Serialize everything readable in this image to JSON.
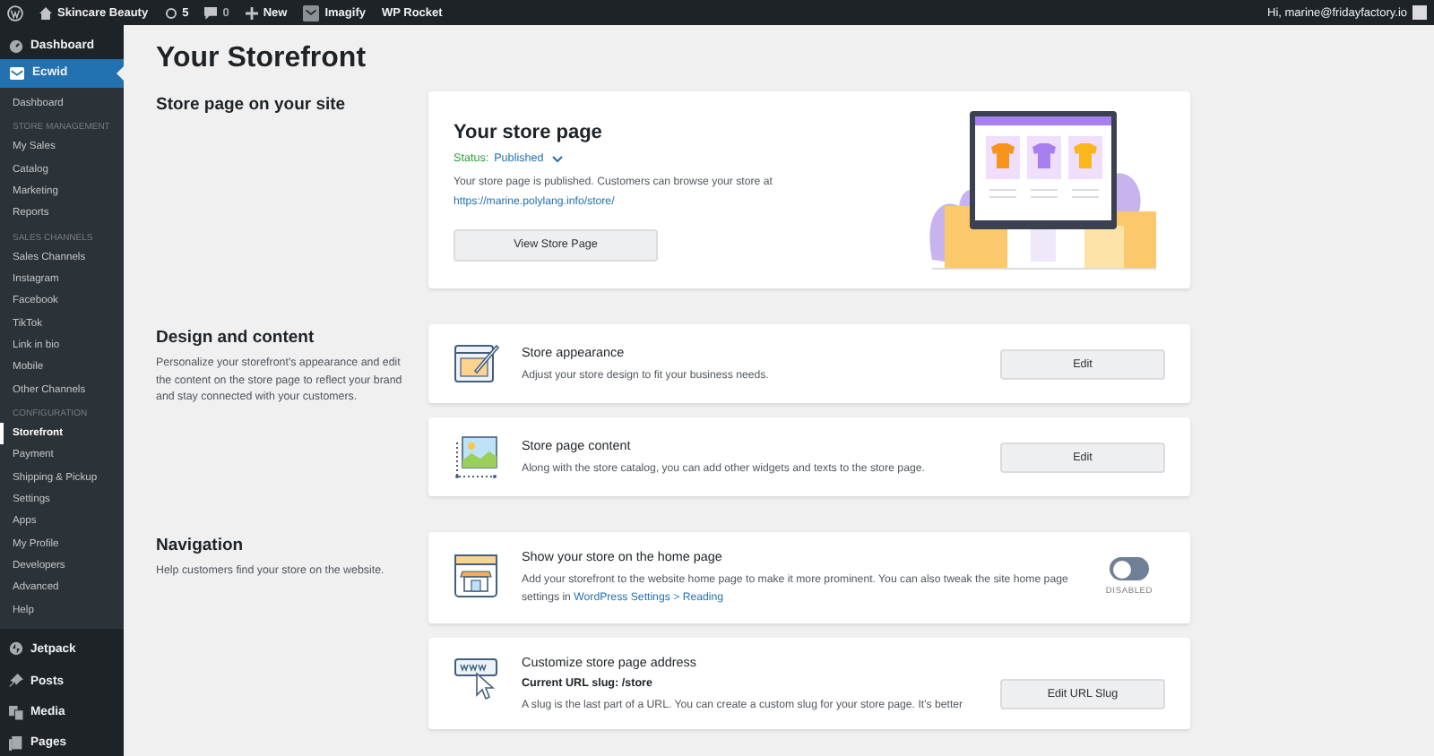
{
  "admin_bar": {
    "site_name": "Skincare Beauty",
    "updates": "5",
    "comments": "0",
    "new_label": "New",
    "plugins": [
      "Imagify",
      "WP Rocket"
    ],
    "greeting": "Hi, marine@fridayfactory.io"
  },
  "sidebar": {
    "items": [
      {
        "kind": "top",
        "label": "Dashboard",
        "selected": false
      },
      {
        "kind": "top",
        "label": "Ecwid",
        "selected": true,
        "children": [
          {
            "kind": "item",
            "label": "Dashboard",
            "selected": false
          },
          {
            "kind": "heading",
            "label": "STORE MANAGEMENT"
          },
          {
            "kind": "item",
            "label": "My Sales",
            "selected": false
          },
          {
            "kind": "item",
            "label": "Catalog",
            "selected": false
          },
          {
            "kind": "item",
            "label": "Marketing",
            "selected": false
          },
          {
            "kind": "item",
            "label": "Reports",
            "selected": false
          },
          {
            "kind": "heading",
            "label": "SALES CHANNELS"
          },
          {
            "kind": "item",
            "label": "Sales Channels",
            "selected": false
          },
          {
            "kind": "item",
            "label": "Instagram",
            "selected": false
          },
          {
            "kind": "item",
            "label": "Facebook",
            "selected": false
          },
          {
            "kind": "item",
            "label": "TikTok",
            "selected": false
          },
          {
            "kind": "item",
            "label": "Link in bio",
            "selected": false
          },
          {
            "kind": "item",
            "label": "Mobile",
            "selected": false
          },
          {
            "kind": "item",
            "label": "Other Channels",
            "selected": false
          },
          {
            "kind": "heading",
            "label": "CONFIGURATION"
          },
          {
            "kind": "item",
            "label": "Storefront",
            "selected": true
          },
          {
            "kind": "item",
            "label": "Payment",
            "selected": false
          },
          {
            "kind": "item",
            "label": "Shipping & Pickup",
            "selected": false
          },
          {
            "kind": "item",
            "label": "Settings",
            "selected": false
          },
          {
            "kind": "item",
            "label": "Apps",
            "selected": false
          },
          {
            "kind": "item",
            "label": "My Profile",
            "selected": false
          },
          {
            "kind": "item",
            "label": "Developers",
            "selected": false
          },
          {
            "kind": "item",
            "label": "Advanced",
            "selected": false
          },
          {
            "kind": "item",
            "label": "Help",
            "selected": false
          }
        ]
      },
      {
        "kind": "top",
        "label": "Jetpack",
        "selected": false
      },
      {
        "kind": "top",
        "label": "Posts",
        "selected": false
      },
      {
        "kind": "top",
        "label": "Media",
        "selected": false
      },
      {
        "kind": "top",
        "label": "Pages",
        "selected": false
      }
    ]
  },
  "page": {
    "title": "Your Storefront",
    "sections": [
      {
        "title": "Store page on your site",
        "cards": [
          {
            "kind": "store_page",
            "title": "Your store page",
            "status_label": "Status:",
            "status_value": "Published",
            "description": "Your store page is published. Customers can browse your store at",
            "link": "https://marine.polylang.info/store/",
            "button": "View Store Page"
          }
        ]
      },
      {
        "title": "Design and content",
        "description": "Personalize your storefront's appearance and edit the content on the store page to reflect your brand and stay connected with your customers.",
        "cards": [
          {
            "kind": "action",
            "title": "Store appearance",
            "description": "Adjust your store design to fit your business needs.",
            "button": "Edit"
          },
          {
            "kind": "action",
            "title": "Store page content",
            "description": "Along with the store catalog, you can add other widgets and texts to the store page.",
            "button": "Edit"
          }
        ]
      },
      {
        "title": "Navigation",
        "description": "Help customers find your store on the website.",
        "cards": [
          {
            "kind": "toggle",
            "title": "Show your store on the home page",
            "description": "Add your storefront to the website home page to make it more prominent. You can also tweak the site home page settings in",
            "link": "WordPress Settings > Reading",
            "on": false,
            "toggle_label": "DISABLED"
          },
          {
            "kind": "action",
            "title": "Customize store page address",
            "subtitle": "Current URL slug: /store",
            "description": "A slug is the last part of a URL. You can create a custom slug for your store page. It's better",
            "button": "Edit URL Slug"
          }
        ]
      }
    ]
  }
}
